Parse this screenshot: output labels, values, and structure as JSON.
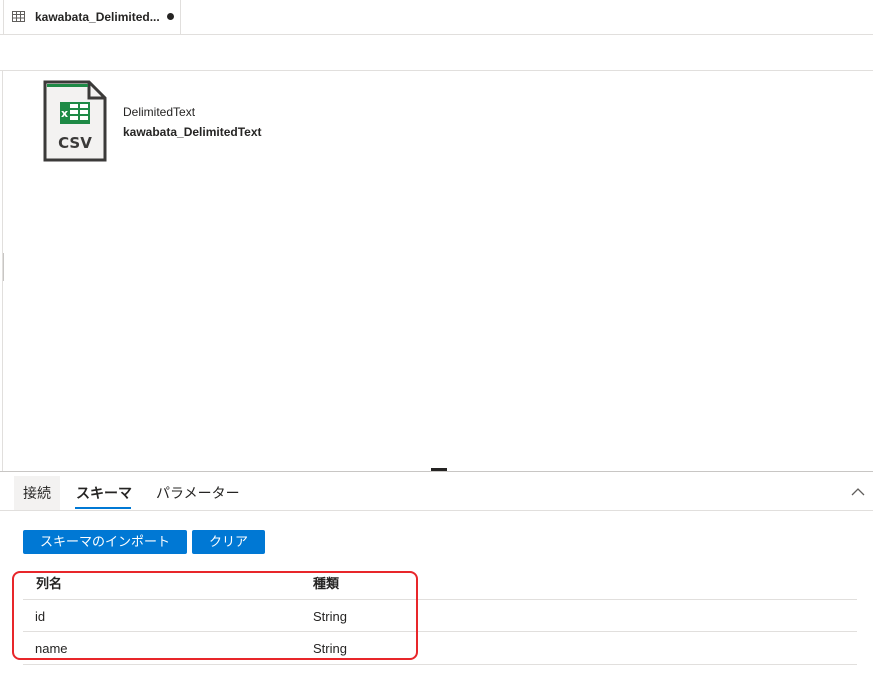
{
  "tab": {
    "icon": "table-icon",
    "title": "kawabata_Delimited...",
    "unsaved": true
  },
  "dataset": {
    "icon": "csv-file-icon",
    "type": "DelimitedText",
    "name": "kawabata_DelimitedText",
    "icon_text": "CSV"
  },
  "panel": {
    "tabs": [
      {
        "label": "接続",
        "active": false
      },
      {
        "label": "スキーマ",
        "active": true
      },
      {
        "label": "パラメーター",
        "active": false
      }
    ],
    "collapse_icon": "chevron-up-icon"
  },
  "actions": {
    "import_label": "スキーマのインポート",
    "clear_label": "クリア"
  },
  "schema_table": {
    "headers": [
      "列名",
      "種類"
    ],
    "rows": [
      {
        "name": "id",
        "type": "String"
      },
      {
        "name": "name",
        "type": "String"
      }
    ]
  },
  "colors": {
    "accent": "#0078d4",
    "highlight": "#e8262a",
    "excel_green": "#1e8a46"
  }
}
